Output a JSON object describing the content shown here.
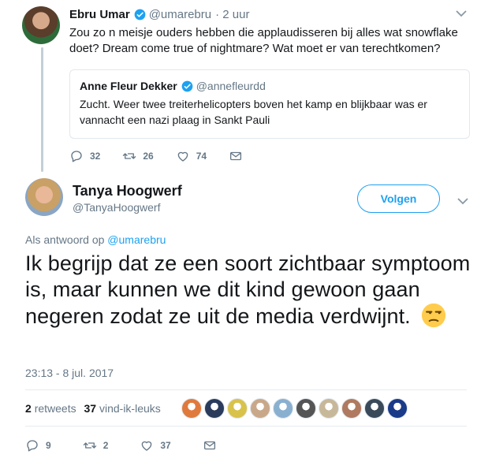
{
  "tweet1": {
    "name": "Ebru Umar",
    "handle": "@umarebru",
    "time": "· 2 uur",
    "text": "Zou zo n meisje ouders hebben die applaudisseren bij alles wat snowflake doet? Dream come true of nightmare? Wat moet er van terechtkomen?",
    "quote": {
      "name": "Anne Fleur Dekker",
      "handle": "@annefleurdd",
      "text": "Zucht. Weer twee treiterhelicopters boven het kamp en blijkbaar was er vannacht een nazi plaag in Sankt Pauli"
    },
    "counts": {
      "replies": "32",
      "retweets": "26",
      "likes": "74"
    }
  },
  "tweet2": {
    "name": "Tanya Hoogwerf",
    "handle": "@TanyaHoogwerf",
    "follow_label": "Volgen",
    "reply_prefix": "Als antwoord op",
    "reply_handle": "@umarebru",
    "text": "Ik begrijp dat ze een soort zichtbaar symptoom is, maar kunnen we dit kind gewoon gaan negeren zodat ze uit de media verdwijnt.",
    "timestamp": "23:13 - 8 jul. 2017",
    "retweet_count": "2",
    "retweet_label": "retweets",
    "like_count": "37",
    "like_label": "vind-ik-leuks",
    "counts": {
      "replies": "9",
      "retweets": "2",
      "likes": "37"
    }
  },
  "colors": {
    "accent": "#1da1f2",
    "muted": "#657786",
    "border": "#e1e8ed"
  },
  "icons": [
    "verified-badge-icon",
    "chevron-down-icon",
    "reply-icon",
    "retweet-icon",
    "like-icon",
    "direct-message-icon",
    "unamused-face-emoji"
  ],
  "likers": [
    {
      "color": "#e07a3c"
    },
    {
      "color": "#2a3b5c"
    },
    {
      "color": "#d9c24a"
    },
    {
      "color": "#c9a88a"
    },
    {
      "color": "#8ab0d0"
    },
    {
      "color": "#555555"
    },
    {
      "color": "#c8b89a"
    },
    {
      "color": "#b07a60"
    },
    {
      "color": "#3a4a5a"
    },
    {
      "color": "#1a3a8a"
    }
  ]
}
